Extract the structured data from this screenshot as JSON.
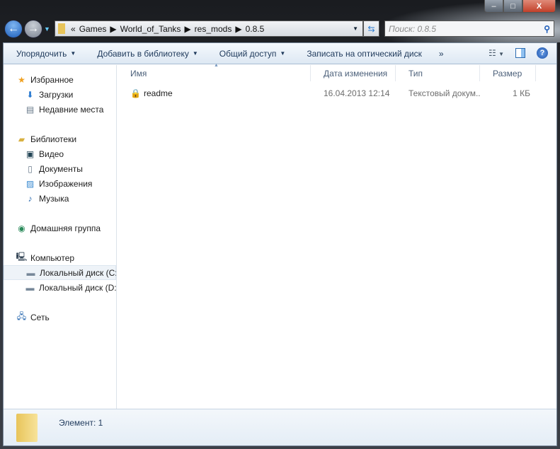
{
  "window": {
    "min": "–",
    "max": "□",
    "close": "X"
  },
  "address": {
    "prefix": "«",
    "crumbs": [
      "Games",
      "World_of_Tanks",
      "res_mods",
      "0.8.5"
    ]
  },
  "search": {
    "placeholder": "Поиск: 0.8.5"
  },
  "toolbar": {
    "organize": "Упорядочить",
    "add_library": "Добавить в библиотеку",
    "share": "Общий доступ",
    "burn": "Записать на оптический диск",
    "more": "»"
  },
  "sidebar": {
    "favorites": {
      "label": "Избранное",
      "items": [
        "Загрузки",
        "Недавние места"
      ]
    },
    "libraries": {
      "label": "Библиотеки",
      "items": [
        "Видео",
        "Документы",
        "Изображения",
        "Музыка"
      ]
    },
    "homegroup": "Домашняя группа",
    "computer": {
      "label": "Компьютер",
      "items": [
        "Локальный диск (C:)",
        "Локальный диск (D:)"
      ]
    },
    "network": "Сеть"
  },
  "columns": [
    "Имя",
    "Дата изменения",
    "Тип",
    "Размер"
  ],
  "files": [
    {
      "name": "readme",
      "date": "16.04.2013 12:14",
      "type": "Текстовый докум...",
      "size": "1 КБ"
    }
  ],
  "status": {
    "text": "Элемент: 1"
  }
}
